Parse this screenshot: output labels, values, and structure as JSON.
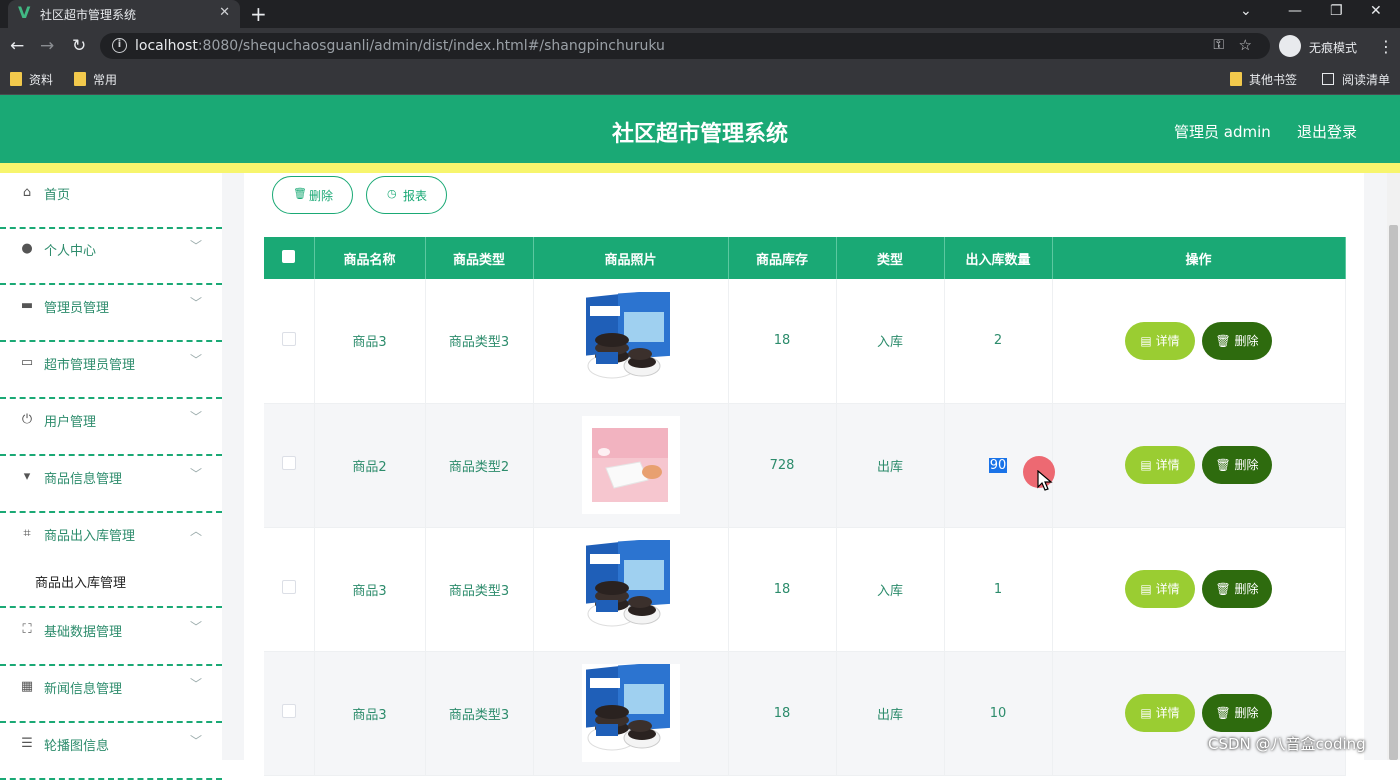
{
  "browser": {
    "tab_title": "社区超市管理系统",
    "tab_close": "✕",
    "new_tab": "+",
    "url_host": "localhost",
    "url_rest": ":8080/shequchaosguanli/admin/dist/index.html#/shangpinchuruku",
    "incognito_label": "无痕模式",
    "bookmarks": [
      "资料",
      "常用"
    ],
    "other_bookmarks": "其他书签",
    "reading_list": "阅读清单"
  },
  "header": {
    "title": "社区超市管理系统",
    "user": "管理员 admin",
    "logout": "退出登录"
  },
  "sidebar": {
    "items": [
      {
        "label": "首页",
        "icon": "home-icon",
        "glyph": "⌂",
        "has_arrow": false
      },
      {
        "label": "个人中心",
        "icon": "user-icon",
        "glyph": "●",
        "has_arrow": true
      },
      {
        "label": "管理员管理",
        "icon": "admin-icon",
        "glyph": "▬",
        "has_arrow": true
      },
      {
        "label": "超市管理员管理",
        "icon": "card-icon",
        "glyph": "▭",
        "has_arrow": true
      },
      {
        "label": "用户管理",
        "icon": "power-icon",
        "glyph": "⏻",
        "has_arrow": true
      },
      {
        "label": "商品信息管理",
        "icon": "goods-icon",
        "glyph": "▾",
        "has_arrow": true
      },
      {
        "label": "商品出入库管理",
        "icon": "crop-icon",
        "glyph": "⌗",
        "has_arrow": true,
        "expanded": true
      },
      {
        "label": "基础数据管理",
        "icon": "frame-icon",
        "glyph": "⛶",
        "has_arrow": true
      },
      {
        "label": "新闻信息管理",
        "icon": "grid-icon",
        "glyph": "▦",
        "has_arrow": true
      },
      {
        "label": "轮播图信息",
        "icon": "list-icon",
        "glyph": "☰",
        "has_arrow": true
      }
    ],
    "sub_item": "商品出入库管理"
  },
  "toolbar": {
    "delete_label": "删除",
    "report_label": "报表"
  },
  "table": {
    "headers": [
      "商品名称",
      "商品类型",
      "商品照片",
      "商品库存",
      "类型",
      "出入库数量",
      "操作"
    ],
    "rows": [
      {
        "name": "商品3",
        "type": "商品类型3",
        "photo": "oreo",
        "stock": "18",
        "io_type": "入库",
        "qty": "2"
      },
      {
        "name": "商品2",
        "type": "商品类型2",
        "photo": "pink",
        "stock": "728",
        "io_type": "出库",
        "qty": "90"
      },
      {
        "name": "商品3",
        "type": "商品类型3",
        "photo": "oreo",
        "stock": "18",
        "io_type": "入库",
        "qty": "1"
      },
      {
        "name": "商品3",
        "type": "商品类型3",
        "photo": "oreo",
        "stock": "18",
        "io_type": "出库",
        "qty": "10"
      }
    ],
    "detail_label": "详情",
    "delete_label": "删除"
  },
  "watermark": "CSDN @八音盒coding",
  "colors": {
    "primary": "#1aa975",
    "accent_yellow": "#f7f56d",
    "detail_button": "#9acd32",
    "delete_button": "#2e6b0e"
  }
}
